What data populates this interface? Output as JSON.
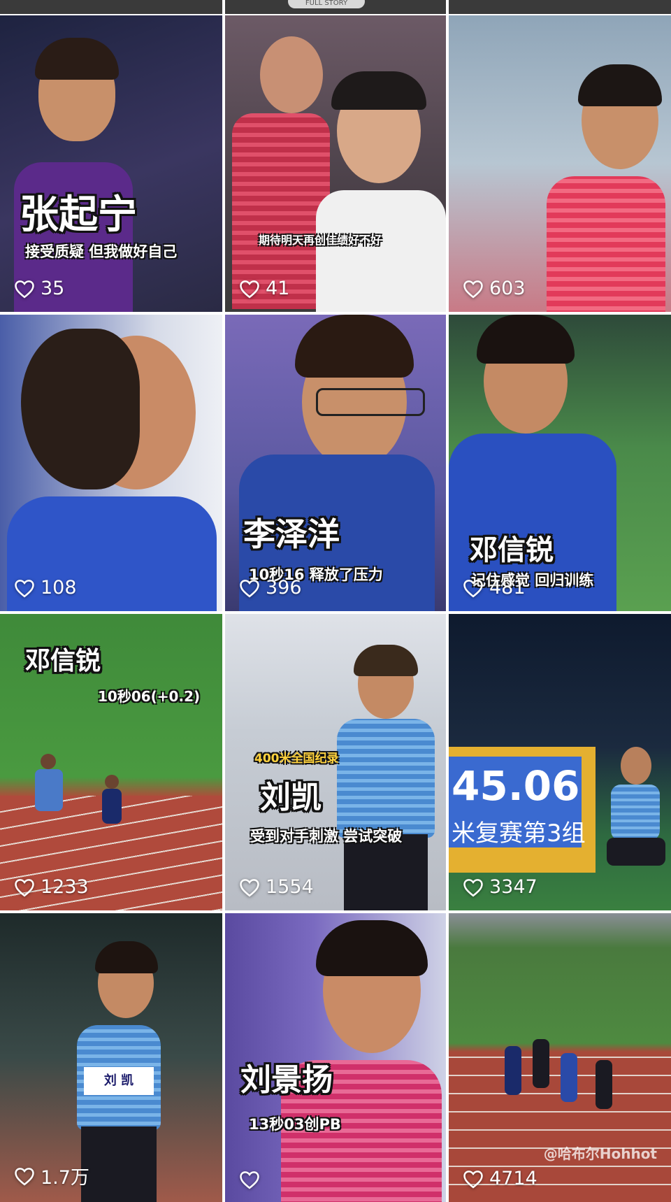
{
  "feed": {
    "top_strip_label": "FULL STORY",
    "tiles": [
      {
        "title": "张起宁",
        "subtitle": "接受质疑  但我做好自己",
        "likes": "35"
      },
      {
        "title": "",
        "subtitle": "期待明天再创佳绩好不好",
        "likes": "41"
      },
      {
        "title": "",
        "subtitle": "",
        "likes": "603"
      },
      {
        "title": "",
        "subtitle": "",
        "likes": "108"
      },
      {
        "title": "李泽洋",
        "subtitle": "10秒16  释放了压力",
        "likes": "396"
      },
      {
        "title": "邓信锐",
        "subtitle": "记住感觉  回归训练",
        "likes": "481"
      },
      {
        "title": "邓信锐",
        "subtitle": "10秒06(+0.2)",
        "likes": "1233"
      },
      {
        "title": "刘凯",
        "subtitle": "受到对手刺激  尝试突破",
        "tag": "400米全国纪录",
        "likes": "1554"
      },
      {
        "title": "",
        "subtitle": "",
        "board_number": "45.06",
        "board_caption": "米复赛第3组",
        "likes": "3347"
      },
      {
        "title": "",
        "subtitle": "",
        "bib": "刘 凯",
        "likes": "1.7万"
      },
      {
        "title": "刘景扬",
        "subtitle": "13秒03创PB",
        "likes": ""
      },
      {
        "title": "",
        "subtitle": "",
        "watermark": "@哈布尔Hohhot",
        "likes": "4714"
      }
    ]
  },
  "colors": {
    "tile_1": "#2b2a4a",
    "tile_2": "#5b4a58",
    "tile_3": "#6f8aa0",
    "tile_4": "#3b63b8",
    "tile_5": "#5a5aa0",
    "tile_6": "#3f7a4a",
    "tile_7": "#3f8a3a",
    "tile_8": "#c9ccd3",
    "tile_9": "#1b2a3f",
    "tile_10": "#2b3a3a",
    "tile_11": "#6a5aa8",
    "tile_12": "#9a4a3a"
  }
}
